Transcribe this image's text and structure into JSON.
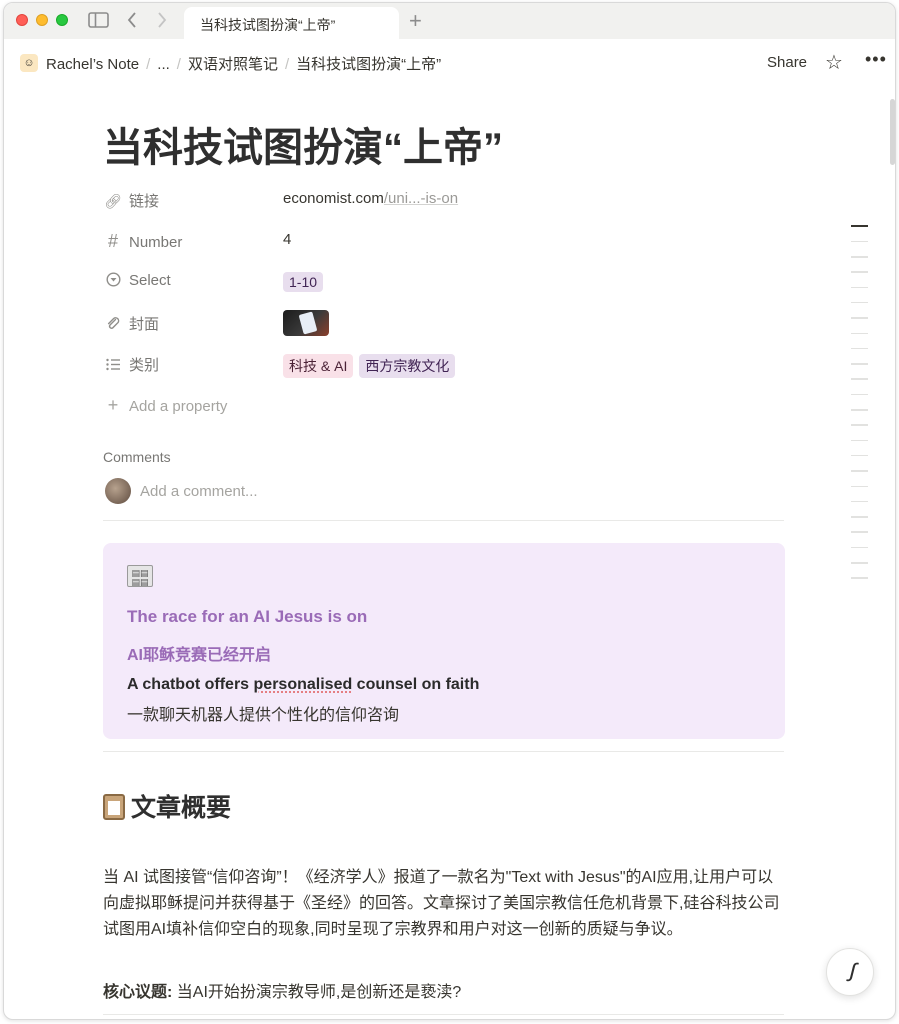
{
  "tab": {
    "title": "当科技试图扮演“上帝”"
  },
  "breadcrumb": {
    "workspace": "Rachel’s Note",
    "ellipsis": "...",
    "parent": "双语对照笔记",
    "current": "当科技试图扮演“上帝”"
  },
  "topbar": {
    "share_label": "Share"
  },
  "page": {
    "title": "当科技试图扮演“上帝”"
  },
  "properties": {
    "link": {
      "name": "链接",
      "value_main": "economist.com",
      "value_rest": "/uni...-is-on"
    },
    "number": {
      "name": "Number",
      "value": "4"
    },
    "select": {
      "name": "Select",
      "value": "1-10"
    },
    "cover": {
      "name": "封面"
    },
    "category": {
      "name": "类别",
      "tags": [
        "科技 & AI",
        "西方宗教文化"
      ]
    },
    "add_label": "Add a property"
  },
  "comments": {
    "label": "Comments",
    "placeholder": "Add a comment..."
  },
  "callout": {
    "line1": "The race for an AI Jesus is on",
    "line2": "AI耶稣竞赛已经开启",
    "line3_pre": "A chatbot offers ",
    "line3_word": "personalised",
    "line3_post": " counsel on faith",
    "line4": "一款聊天机器人提供个性化的信仰咨询"
  },
  "section": {
    "heading": "文章概要"
  },
  "summary": {
    "paragraph": "当 AI 试图接管“信仰咨询”！《经济学人》报道了一款名为\"Text with Jesus\"的AI应用,让用户可以向虚拟耶稣提问并获得基于《圣经》的回答。文章探讨了美国宗教信任危机背景下,硅谷科技公司试图用AI填补信仰空白的现象,同时呈现了宗教界和用户对这一创新的质疑与争议。",
    "core_label": "核心议题:",
    "core_text": " 当AI开始扮演宗教导师,是创新还是亵渎?"
  },
  "colors": {
    "callout_bg": "#f4eafa",
    "callout_accent": "#9a6bb7",
    "tag_purple": "#e8deee",
    "tag_pink": "#f9e1e8"
  }
}
